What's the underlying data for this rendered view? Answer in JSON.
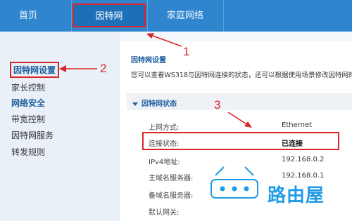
{
  "topnav": {
    "tabs": [
      {
        "label": "首页"
      },
      {
        "label": "因特网"
      },
      {
        "label": "家庭网络"
      }
    ]
  },
  "sidebar": {
    "items": [
      {
        "label": "因特网设置"
      },
      {
        "label": "家长控制"
      },
      {
        "label": "网络安全"
      },
      {
        "label": "带宽控制"
      },
      {
        "label": "因特网服务"
      },
      {
        "label": "转发规则"
      }
    ]
  },
  "main": {
    "page_title": "因特网设置",
    "description": "您可以查看WS318与因特网连接的状态，还可以根据使用场景修改因特网的",
    "section_title": "因特网状态",
    "rows": [
      {
        "label": "上网方式:",
        "value": "Ethernet"
      },
      {
        "label": "连接状态:",
        "value": "已连接"
      },
      {
        "label": "IPv4地址:",
        "value": "192.168.0.2"
      },
      {
        "label": "主域名服务器:",
        "value": "192.168.0.1"
      },
      {
        "label": "备域名服务器:",
        "value": ""
      },
      {
        "label": "默认网关:",
        "value": ""
      }
    ]
  },
  "annotations": {
    "n1": "1",
    "n2": "2",
    "n3": "3",
    "color": "#d9242a"
  },
  "watermark": {
    "text": "路由屋",
    "color": "#1e9be6"
  },
  "colors": {
    "nav_bg": "#2f86cf",
    "nav_active": "#1d6fb8",
    "link_blue": "#1f5f9f"
  }
}
